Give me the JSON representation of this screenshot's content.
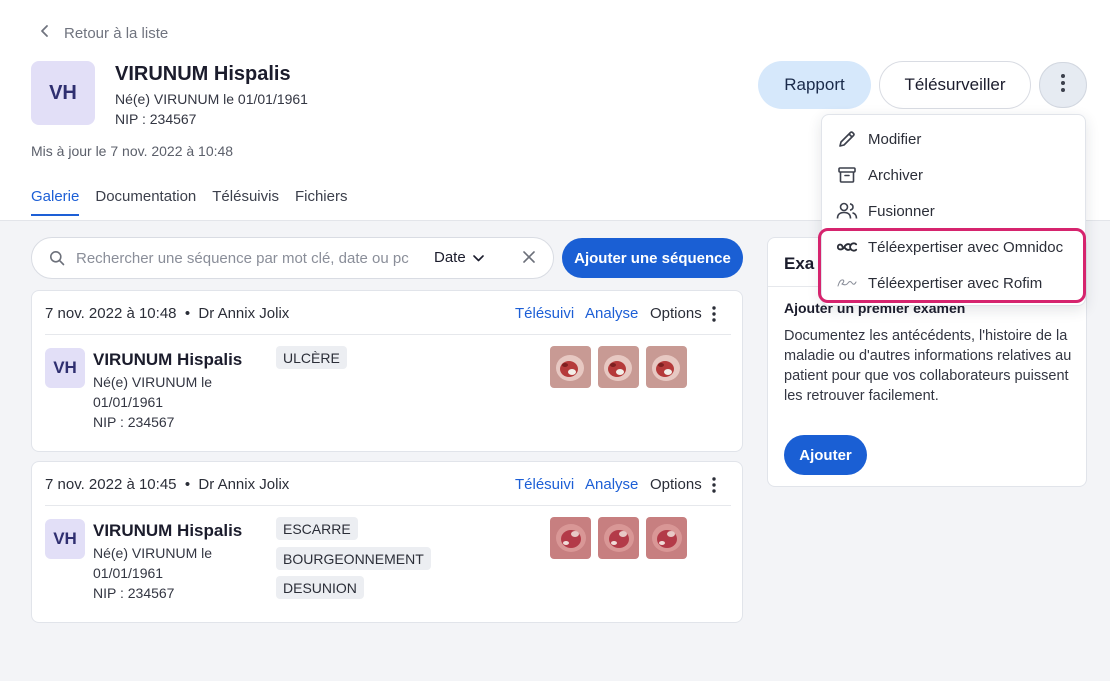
{
  "back_label": "Retour à la liste",
  "patient": {
    "initials": "VH",
    "name": "VIRUNUM Hispalis",
    "born": "Né(e) VIRUNUM le 01/01/1961",
    "nip": "NIP : 234567",
    "updated": "Mis à jour le 7 nov. 2022 à 10:48"
  },
  "tabs": [
    {
      "label": "Galerie",
      "active": true
    },
    {
      "label": "Documentation",
      "active": false
    },
    {
      "label": "Télésuivis",
      "active": false
    },
    {
      "label": "Fichiers",
      "active": false
    }
  ],
  "actions": {
    "rapport": "Rapport",
    "telesurveiller": "Télésurveiller"
  },
  "menu": {
    "items": [
      {
        "label": "Modifier",
        "icon": "pencil-icon"
      },
      {
        "label": "Archiver",
        "icon": "archive-icon"
      },
      {
        "label": "Fusionner",
        "icon": "users-icon"
      },
      {
        "label": "Téléexpertiser avec Omnidoc",
        "icon": "omnidoc-logo-icon"
      },
      {
        "label": "Téléexpertiser avec Rofim",
        "icon": "rofim-logo-icon"
      }
    ],
    "highlight_color": "#d6246e"
  },
  "search": {
    "placeholder": "Rechercher une séquence par mot clé, date ou pc",
    "value": "",
    "sort_label": "Date"
  },
  "add_sequence_label": "Ajouter une séquence",
  "sequences": [
    {
      "header": "7 nov. 2022 à 10:48  •  Dr Annix Jolix",
      "links": {
        "telesuivi": "Télésuivi",
        "analyse": "Analyse",
        "options": "Options"
      },
      "initials": "VH",
      "name": "VIRUNUM Hispalis",
      "born1": "Né(e) VIRUNUM le",
      "born2": "01/01/1961",
      "nip": "NIP : 234567",
      "tags": [
        "ULCÈRE"
      ]
    },
    {
      "header": "7 nov. 2022 à 10:45  •  Dr Annix Jolix",
      "links": {
        "telesuivi": "Télésuivi",
        "analyse": "Analyse",
        "options": "Options"
      },
      "initials": "VH",
      "name": "VIRUNUM Hispalis",
      "born1": "Né(e) VIRUNUM le",
      "born2": "01/01/1961",
      "nip": "NIP : 234567",
      "tags": [
        "ESCARRE",
        "BOURGEONNEMENT",
        "DESUNION"
      ]
    }
  ],
  "exam_panel": {
    "title": "Exa",
    "subtitle": "Ajouter un premier examen",
    "description": "Documentez les antécédents, l'histoire de la maladie ou d'autres informations relatives au patient pour que vos collaborateurs puissent les retrouver facilement.",
    "button": "Ajouter"
  },
  "colors": {
    "primary": "#1a5fd4",
    "rapport_bg": "#d6e8fb",
    "avatar_bg": "#e2dff7"
  }
}
